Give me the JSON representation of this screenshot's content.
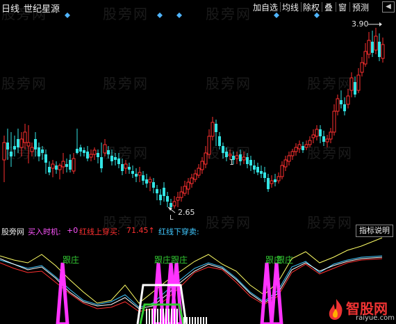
{
  "toolbar": {
    "period": "日线",
    "stock_name": "世纪星源",
    "add_watchlist": "加自选",
    "ma_label": "均线",
    "ex_rights": "除权",
    "overlay": "叠",
    "window": "窗",
    "forecast": "预测",
    "close_symbol": "◀"
  },
  "main_chart": {
    "high_label": "3.90",
    "low_label": "2.65",
    "mid_label": "1",
    "low_marker": "L",
    "colors": {
      "up": "#ff3030",
      "down": "#33e5e5",
      "marker": "#4fb4ff",
      "label": "#e0e0e0"
    }
  },
  "indicator": {
    "name": "股旁网",
    "buy_label": "买入时机:",
    "buy_value": "+0",
    "red_up_label": "红线上穿买:",
    "red_up_value": "71.45↑",
    "red_down_label": "红线下穿卖:",
    "help_button": "指标说明",
    "annotations": [
      "跟庄",
      "跟庄",
      "跟庄",
      "跟庄",
      "跟庄"
    ],
    "colors": {
      "magenta": "#ff33ff",
      "white": "#ffffff",
      "cyan": "#40c8ff",
      "yellow": "#ffff66",
      "red": "#ff3030",
      "green": "#33cc33"
    }
  },
  "watermark_text": "股旁网",
  "logo": {
    "text": "智股网",
    "sub": "raiyue.com"
  }
}
